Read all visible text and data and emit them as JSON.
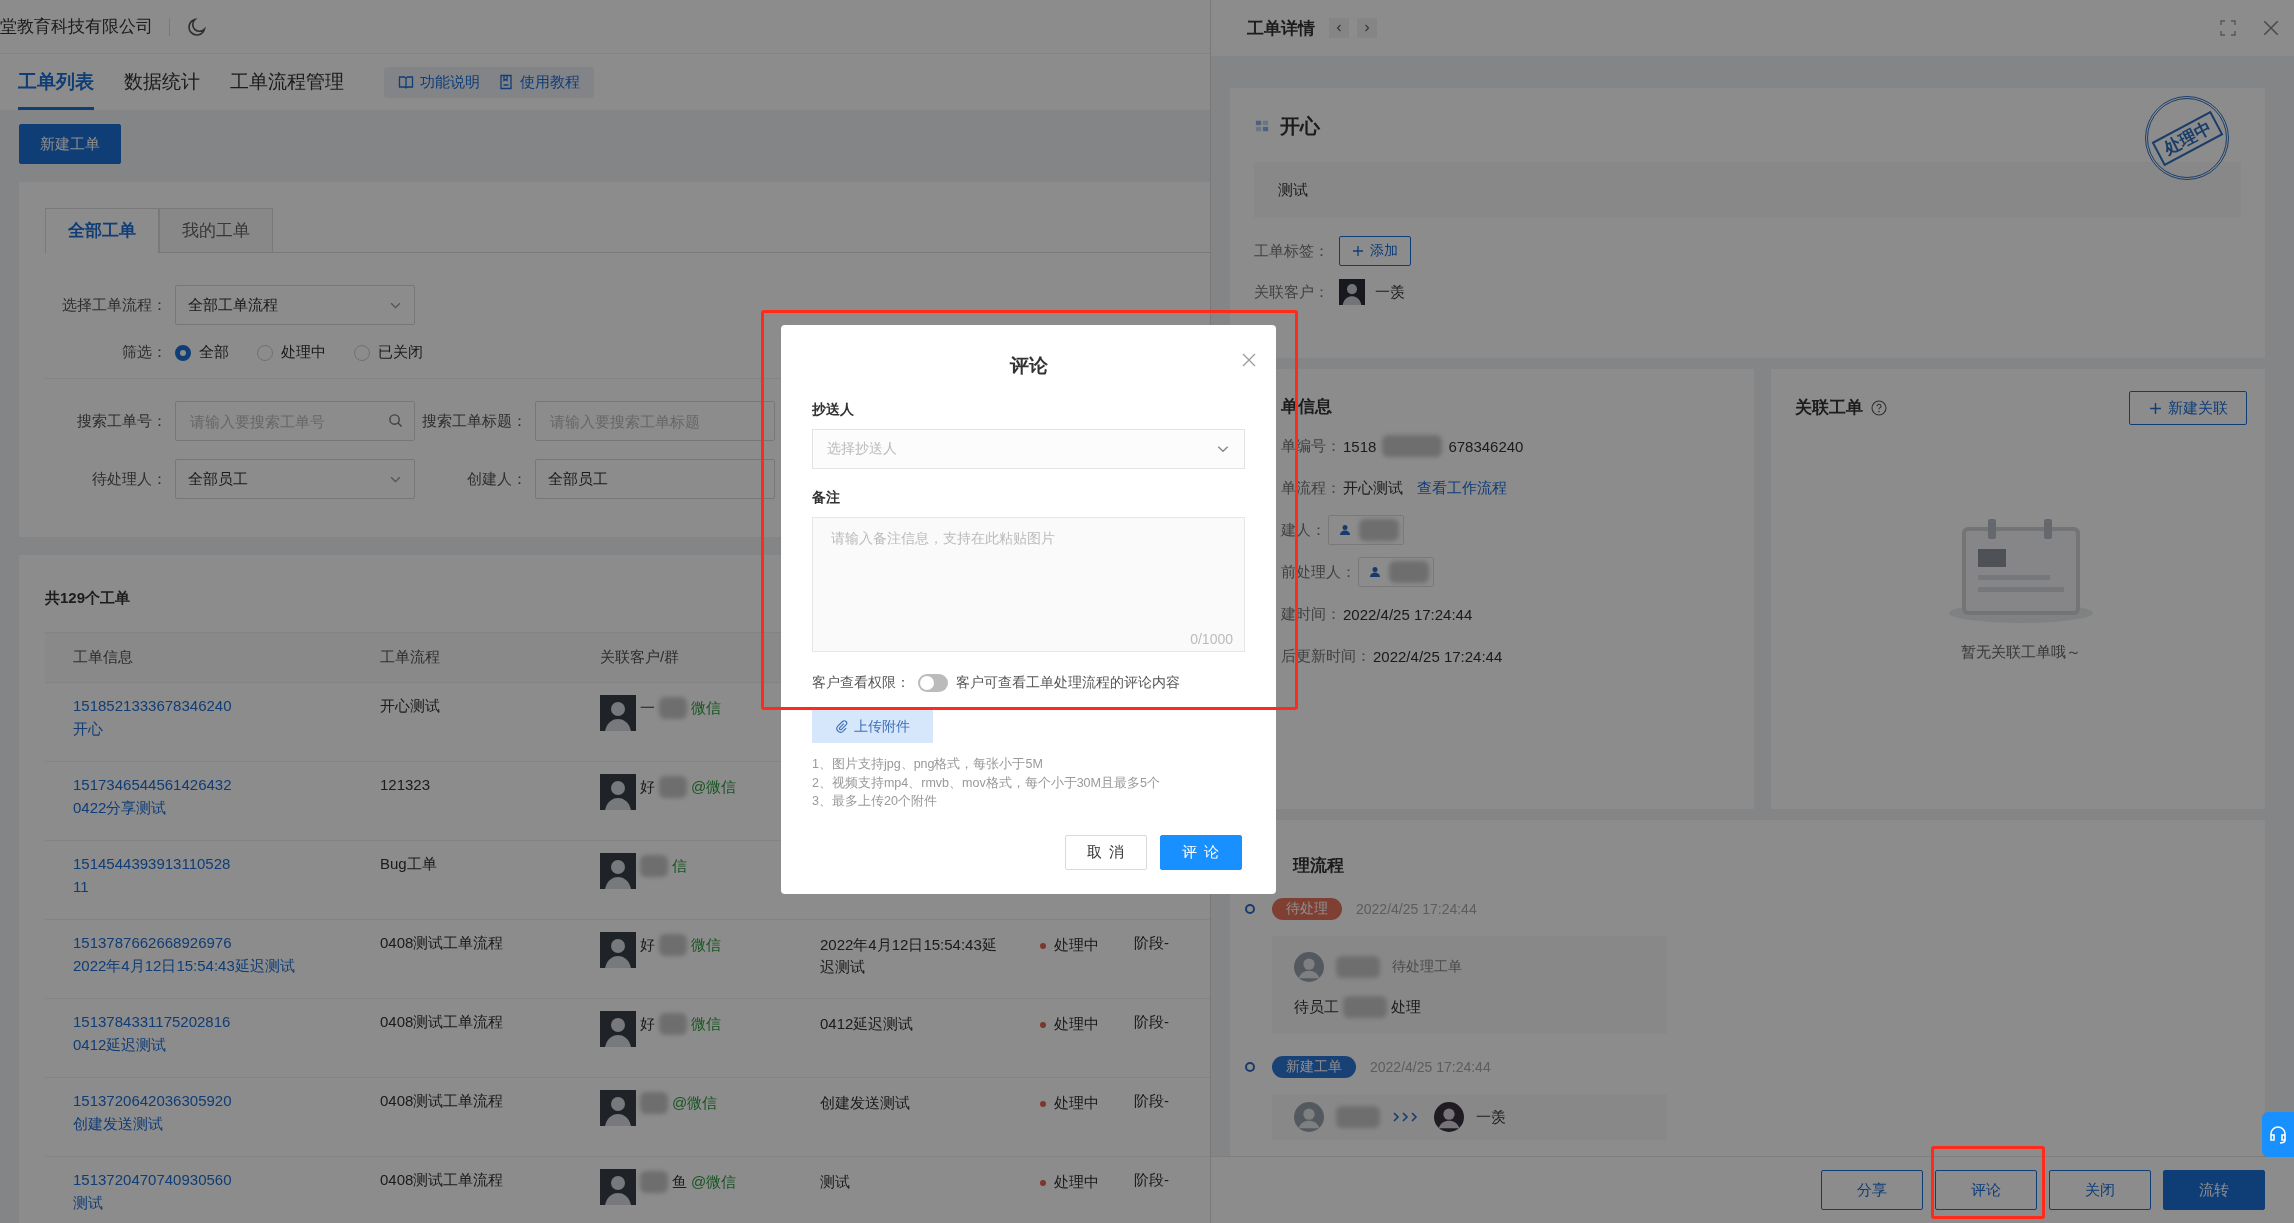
{
  "header": {
    "company": "堂教育科技有限公司"
  },
  "nav_tabs": [
    {
      "label": "工单列表",
      "selected": true
    },
    {
      "label": "数据统计",
      "selected": false
    },
    {
      "label": "工单流程管理",
      "selected": false
    }
  ],
  "help_links": [
    "功能说明",
    "使用教程"
  ],
  "new_button": "新建工单",
  "filter": {
    "tabs": [
      {
        "label": "全部工单",
        "selected": true
      },
      {
        "label": "我的工单",
        "selected": false
      }
    ],
    "flow": {
      "label": "选择工单流程：",
      "value": "全部工单流程"
    },
    "status_filter": {
      "label": "筛选：",
      "options": [
        {
          "label": "全部",
          "selected": true
        },
        {
          "label": "处理中",
          "selected": false
        },
        {
          "label": "已关闭",
          "selected": false
        }
      ]
    },
    "search_id": {
      "label": "搜索工单号：",
      "placeholder": "请输入要搜索工单号"
    },
    "search_title": {
      "label": "搜索工单标题：",
      "placeholder": "请输入要搜索工单标题"
    },
    "assignee": {
      "label": "待处理人：",
      "value": "全部员工"
    },
    "creator": {
      "label": "创建人：",
      "value": "全部员工"
    }
  },
  "table": {
    "count": "共129个工单",
    "columns": [
      "工单信息",
      "工单流程",
      "关联客户/群"
    ],
    "rows": [
      {
        "id": "1518521333678346240",
        "title": "开心",
        "flow": "开心测试",
        "customer": {
          "start": "一",
          "channel": "微信"
        }
      },
      {
        "id": "1517346544561426432",
        "title": "0422分享测试",
        "flow": "121323",
        "customer": {
          "start": "好",
          "channel": "@微信"
        }
      },
      {
        "id": "1514544393913110528",
        "title": "11",
        "flow": "Bug工单",
        "customer": {
          "channel": "信"
        }
      },
      {
        "id": "1513787662668926976",
        "title": "2022年4月12日15:54:43延迟测试",
        "flow": "0408测试工单流程",
        "customer": {
          "start": "好",
          "channel": "微信"
        },
        "column_4": "2022年4月12日15:54:43延迟测试",
        "status": "处理中",
        "stage": "阶段-"
      },
      {
        "id": "1513784331175202816",
        "title": "0412延迟测试",
        "flow": "0408测试工单流程",
        "customer": {
          "start": "好",
          "channel": "微信"
        },
        "column_4": "0412延迟测试",
        "status": "处理中",
        "stage": "阶段-"
      },
      {
        "id": "1513720642036305920",
        "title": "创建发送测试",
        "flow": "0408测试工单流程",
        "customer": {
          "channel": "@微信"
        },
        "column_4": "创建发送测试",
        "status": "处理中",
        "stage": "阶段-"
      },
      {
        "id": "1513720470740930560",
        "title": "测试",
        "flow": "0408测试工单流程",
        "customer": {
          "end": "鱼",
          "channel": "@微信"
        },
        "column_4": "测试",
        "status": "处理中",
        "stage": "阶段-"
      }
    ]
  },
  "drawer": {
    "title": "工单详情",
    "ticket": {
      "title": "开心",
      "stamp": "处理中",
      "description": "测试",
      "tags_label": "工单标签：",
      "add_tag": "添加",
      "customer_label": "关联客户：",
      "customer": "一羡"
    },
    "info": {
      "title": "单信息",
      "rows": [
        {
          "label": "单编号：",
          "kind": "id",
          "start": "1518",
          "end": "678346240"
        },
        {
          "label": "单流程：",
          "kind": "link",
          "value": "开心测试",
          "link": "查看工作流程"
        },
        {
          "label": "建人：",
          "kind": "user"
        },
        {
          "label": "前处理人：",
          "kind": "user"
        },
        {
          "label": "建时间：",
          "kind": "text",
          "value": "2022/4/25 17:24:44"
        },
        {
          "label": "后更新时间：",
          "kind": "text",
          "value": "2022/4/25 17:24:44"
        }
      ]
    },
    "related": {
      "title": "关联工单",
      "button": "新建关联",
      "empty": "暂无关联工单哦～"
    },
    "process": {
      "title": "理流程",
      "steps": [
        {
          "kind": "pending",
          "tag": "待处理",
          "time": "2022/4/25 17:24:44",
          "action": "待处理工单",
          "note_start": "待员工",
          "note_end": "处理"
        },
        {
          "kind": "created",
          "tag": "新建工单",
          "time": "2022/4/25 17:24:44",
          "target": "一羡"
        }
      ]
    },
    "footer": [
      {
        "label": "分享",
        "kind": "default"
      },
      {
        "label": "评论",
        "kind": "default"
      },
      {
        "label": "关闭",
        "kind": "default"
      },
      {
        "label": "流转",
        "kind": "primary"
      }
    ]
  },
  "modal": {
    "title": "评论",
    "cc": {
      "label": "抄送人",
      "placeholder": "选择抄送人"
    },
    "remark": {
      "label": "备注",
      "placeholder": "请输入备注信息，支持在此粘贴图片",
      "counter": "0/1000"
    },
    "visibility": {
      "label": "客户查看权限：",
      "on": false,
      "hint": "客户可查看工单处理流程的评论内容"
    },
    "upload": "上传附件",
    "notes": [
      "1、图片支持jpg、png格式，每张小于5M",
      "2、视频支持mp4、rmvb、mov格式，每个小于30M且最多5个",
      "3、最多上传20个附件"
    ],
    "buttons": [
      {
        "label": "取 消",
        "kind": "default"
      },
      {
        "label": "评 论",
        "kind": "primary"
      }
    ]
  }
}
